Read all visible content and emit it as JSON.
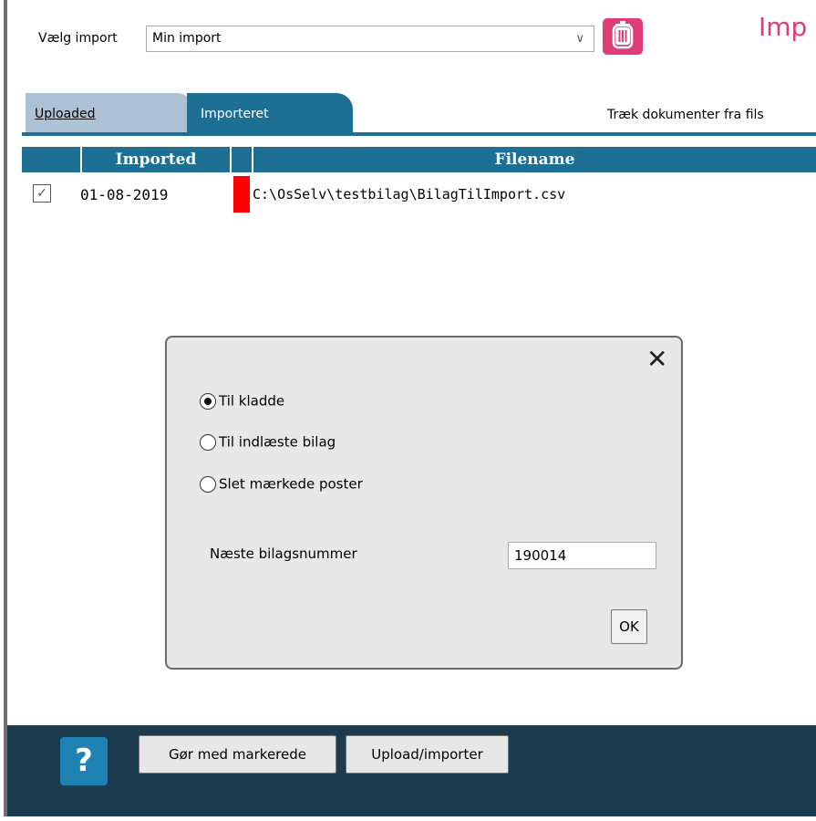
{
  "top": {
    "import_label": "Vælg import",
    "import_value": "Min import",
    "title": "Imp"
  },
  "tabs": [
    {
      "label": "Uploaded",
      "active": false
    },
    {
      "label": "Importeret",
      "active": true
    }
  ],
  "drag_hint": "Træk dokumenter fra fils",
  "table": {
    "headers": [
      "",
      "Imported",
      "",
      "Filename"
    ],
    "rows": [
      {
        "checked": true,
        "imported": "01-08-2019",
        "filename": "C:\\OsSelv\\testbilag\\BilagTilImport.csv",
        "flag_color": "#ff0000"
      }
    ]
  },
  "dialog": {
    "options": [
      {
        "label": "Til kladde",
        "selected": true
      },
      {
        "label": "Til indlæste bilag",
        "selected": false
      },
      {
        "label": "Slet mærkede poster",
        "selected": false
      }
    ],
    "next_label": "Næste bilagsnummer",
    "next_value": "190014",
    "ok_label": "OK"
  },
  "footer": {
    "help_label": "?",
    "mark_button": "Gør med markerede",
    "upload_button": "Upload/importer"
  },
  "colors": {
    "accent": "#1e6f94",
    "brand_pink": "#e03c78",
    "footer_bg": "#1d3b4f"
  }
}
